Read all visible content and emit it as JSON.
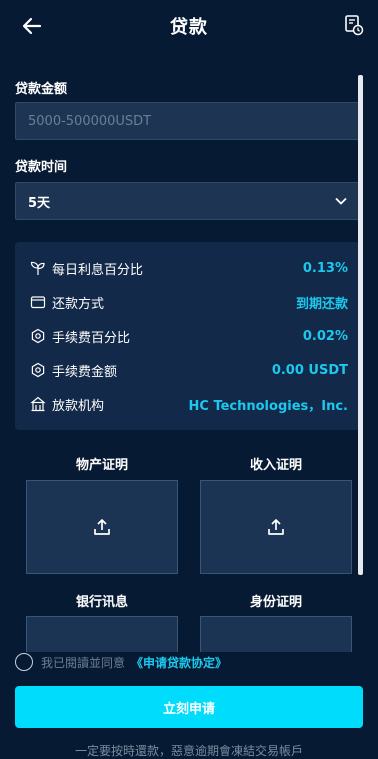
{
  "header": {
    "title": "贷款"
  },
  "form": {
    "amount_label": "贷款金额",
    "amount_placeholder": "5000-500000USDT",
    "term_label": "贷款时间",
    "term_value": "5天"
  },
  "info": {
    "rows": [
      {
        "label": "每日利息百分比",
        "value": "0.13%",
        "icon": "sprout-icon"
      },
      {
        "label": "还款方式",
        "value": "到期还款",
        "icon": "wallet-icon"
      },
      {
        "label": "手续费百分比",
        "value": "0.02%",
        "icon": "hexagon-icon"
      },
      {
        "label": "手续费金额",
        "value": "0.00 USDT",
        "icon": "hexagon-icon"
      },
      {
        "label": "放款机构",
        "value": "HC Technologies，Inc.",
        "icon": "bank-icon"
      }
    ]
  },
  "uploads": {
    "property_proof": "物产证明",
    "income_proof": "收入证明",
    "bank_info": "银行讯息",
    "id_proof": "身份证明"
  },
  "agreement": {
    "text": "我已閱讀並同意",
    "link": "《申请贷款协定》"
  },
  "submit_label": "立刻申请",
  "footer_note": "一定要按時還款，惡意逾期會凍結交易帳戶",
  "colors": {
    "background": "#071a33",
    "accent": "#1cc8ee",
    "button": "#00dcfc"
  }
}
